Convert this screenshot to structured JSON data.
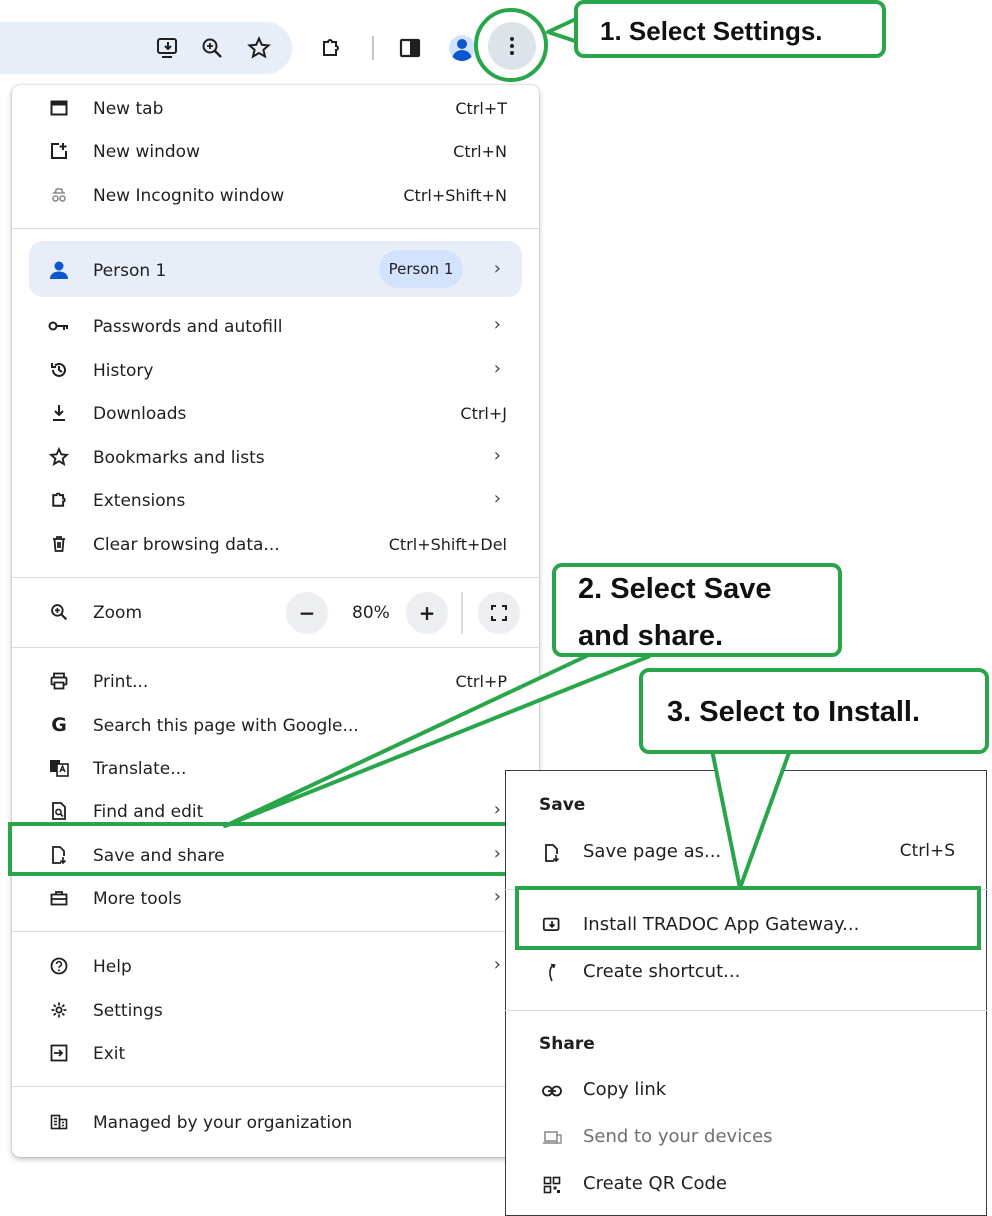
{
  "menu": {
    "items": [
      {
        "label": "New tab",
        "shortcut": "Ctrl+T",
        "icon": "new-tab-icon"
      },
      {
        "label": "New window",
        "shortcut": "Ctrl+N",
        "icon": "new-window-icon"
      },
      {
        "label": "New Incognito window",
        "shortcut": "Ctrl+Shift+N",
        "icon": "incognito-icon"
      }
    ],
    "person": {
      "label": "Person 1",
      "chip": "Person 1"
    },
    "items2": [
      {
        "label": "Passwords and autofill",
        "icon": "key-icon"
      },
      {
        "label": "History",
        "icon": "history-icon"
      },
      {
        "label": "Downloads",
        "shortcut": "Ctrl+J",
        "icon": "download-icon"
      },
      {
        "label": "Bookmarks and lists",
        "icon": "star-icon"
      },
      {
        "label": "Extensions",
        "icon": "puzzle-icon"
      },
      {
        "label": "Clear browsing data...",
        "shortcut": "Ctrl+Shift+Del",
        "icon": "trash-icon"
      }
    ],
    "zoom": {
      "label": "Zoom",
      "value": "80%",
      "minus": "−",
      "plus": "+"
    },
    "items3": [
      {
        "label": "Print...",
        "shortcut": "Ctrl+P",
        "icon": "print-icon"
      },
      {
        "label": "Search this page with Google...",
        "icon": "google-icon"
      },
      {
        "label": "Translate...",
        "icon": "translate-icon"
      },
      {
        "label": "Find and edit",
        "icon": "find-icon"
      },
      {
        "label": "Save and share",
        "icon": "save-share-icon"
      },
      {
        "label": "More tools",
        "icon": "toolbox-icon"
      }
    ],
    "items4": [
      {
        "label": "Help",
        "icon": "help-icon"
      },
      {
        "label": "Settings",
        "icon": "gear-icon"
      },
      {
        "label": "Exit",
        "icon": "exit-icon"
      }
    ],
    "managed": {
      "label": "Managed by your organization",
      "icon": "building-icon"
    }
  },
  "submenu": {
    "save_heading": "Save",
    "save_page": {
      "label": "Save page as...",
      "shortcut": "Ctrl+S"
    },
    "install": {
      "label": "Install TRADOC App Gateway..."
    },
    "shortcut": {
      "label": "Create shortcut..."
    },
    "share_heading": "Share",
    "copy_link": {
      "label": "Copy link"
    },
    "send_devices": {
      "label": "Send to your devices"
    },
    "qr": {
      "label": "Create QR Code"
    }
  },
  "callouts": {
    "step1": "1. Select Settings.",
    "step2_line1": "2. Select Save",
    "step2_line2": "and share.",
    "step3": "3. Select to Install."
  },
  "colors": {
    "highlight": "#2aa64a",
    "accent": "#0b57d0",
    "card": "#e8eef8"
  }
}
